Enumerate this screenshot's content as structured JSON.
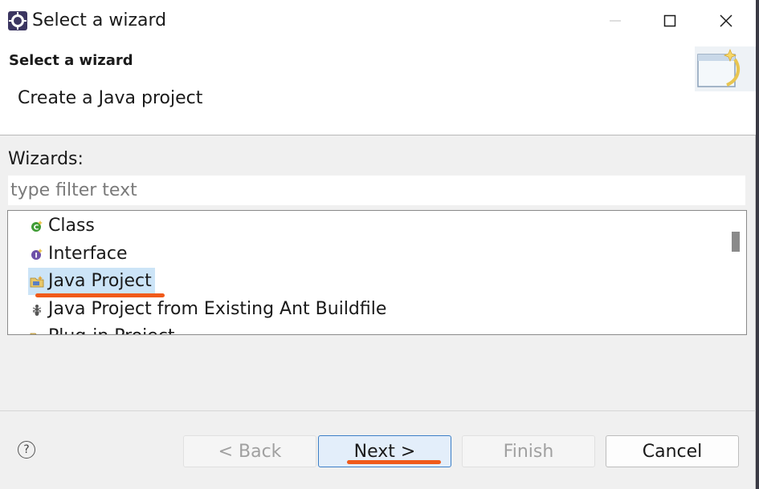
{
  "window": {
    "title": "Select a wizard",
    "controls": {
      "minimize": "minimize-icon",
      "maximize": "maximize-icon",
      "close": "close-icon"
    }
  },
  "banner": {
    "title": "Select a wizard",
    "description": "Create a Java project",
    "image": "wizard-banner-icon"
  },
  "wizards": {
    "label": "Wizards:",
    "filter_placeholder": "type filter text",
    "filter_value": "",
    "items": [
      {
        "label": "Class",
        "icon": "class-icon",
        "selected": false
      },
      {
        "label": "Interface",
        "icon": "interface-icon",
        "selected": false
      },
      {
        "label": "Java Project",
        "icon": "java-project-icon",
        "selected": true
      },
      {
        "label": "Java Project from Existing Ant Buildfile",
        "icon": "ant-icon",
        "selected": false
      },
      {
        "label": "Plug-in Project",
        "icon": "plugin-project-icon",
        "selected": false
      }
    ]
  },
  "buttons": {
    "back": "< Back",
    "next": "Next >",
    "finish": "Finish",
    "cancel": "Cancel",
    "help": "?"
  },
  "colors": {
    "selection": "#cce4f7",
    "highlight_mark": "#f05a1a",
    "default_button_border": "#3c7fc7"
  }
}
